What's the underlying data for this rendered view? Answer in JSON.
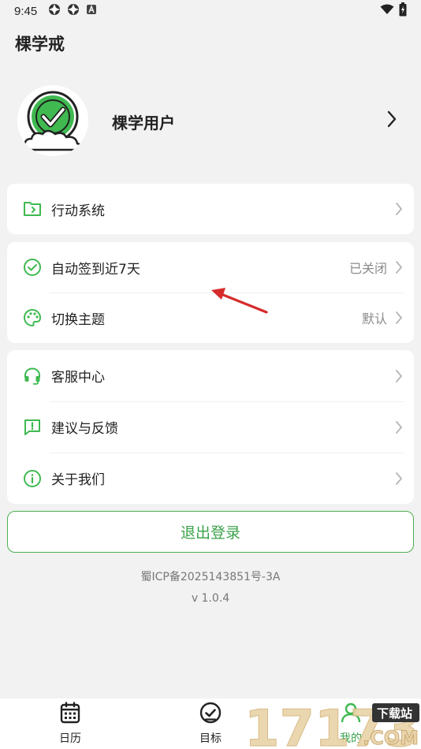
{
  "status_bar": {
    "time": "9:45",
    "left_icons": [
      "app-icon",
      "app-icon",
      "notification-a-icon"
    ],
    "right_icons": [
      "wifi-icon",
      "battery-icon"
    ]
  },
  "app": {
    "title": "棵学戒",
    "accent_color": "#4caf50"
  },
  "profile": {
    "username": "棵学用户",
    "avatar_icon": "check-circle-cloud-icon"
  },
  "card_action": {
    "items": [
      {
        "icon": "folder-icon",
        "label": "行动系统",
        "value": ""
      }
    ]
  },
  "card_settings": {
    "items": [
      {
        "icon": "check-circle-icon",
        "label": "自动签到近7天",
        "value": "已关闭"
      },
      {
        "icon": "palette-icon",
        "label": "切换主题",
        "value": "默认"
      }
    ]
  },
  "card_support": {
    "items": [
      {
        "icon": "headset-icon",
        "label": "客服中心",
        "value": ""
      },
      {
        "icon": "feedback-icon",
        "label": "建议与反馈",
        "value": ""
      },
      {
        "icon": "info-icon",
        "label": "关于我们",
        "value": ""
      }
    ]
  },
  "logout_label": "退出登录",
  "footer": {
    "icp": "蜀ICP备2025143851号-3A",
    "version": "v 1.0.4"
  },
  "bottom_nav": {
    "items": [
      {
        "icon": "calendar-icon",
        "label": "日历"
      },
      {
        "icon": "target-check-icon",
        "label": "目标"
      },
      {
        "icon": "user-icon",
        "label": "我的"
      }
    ]
  },
  "watermark": {
    "text_main": "17173",
    "text_tag": "下载站",
    "text_domain": ".COM"
  }
}
